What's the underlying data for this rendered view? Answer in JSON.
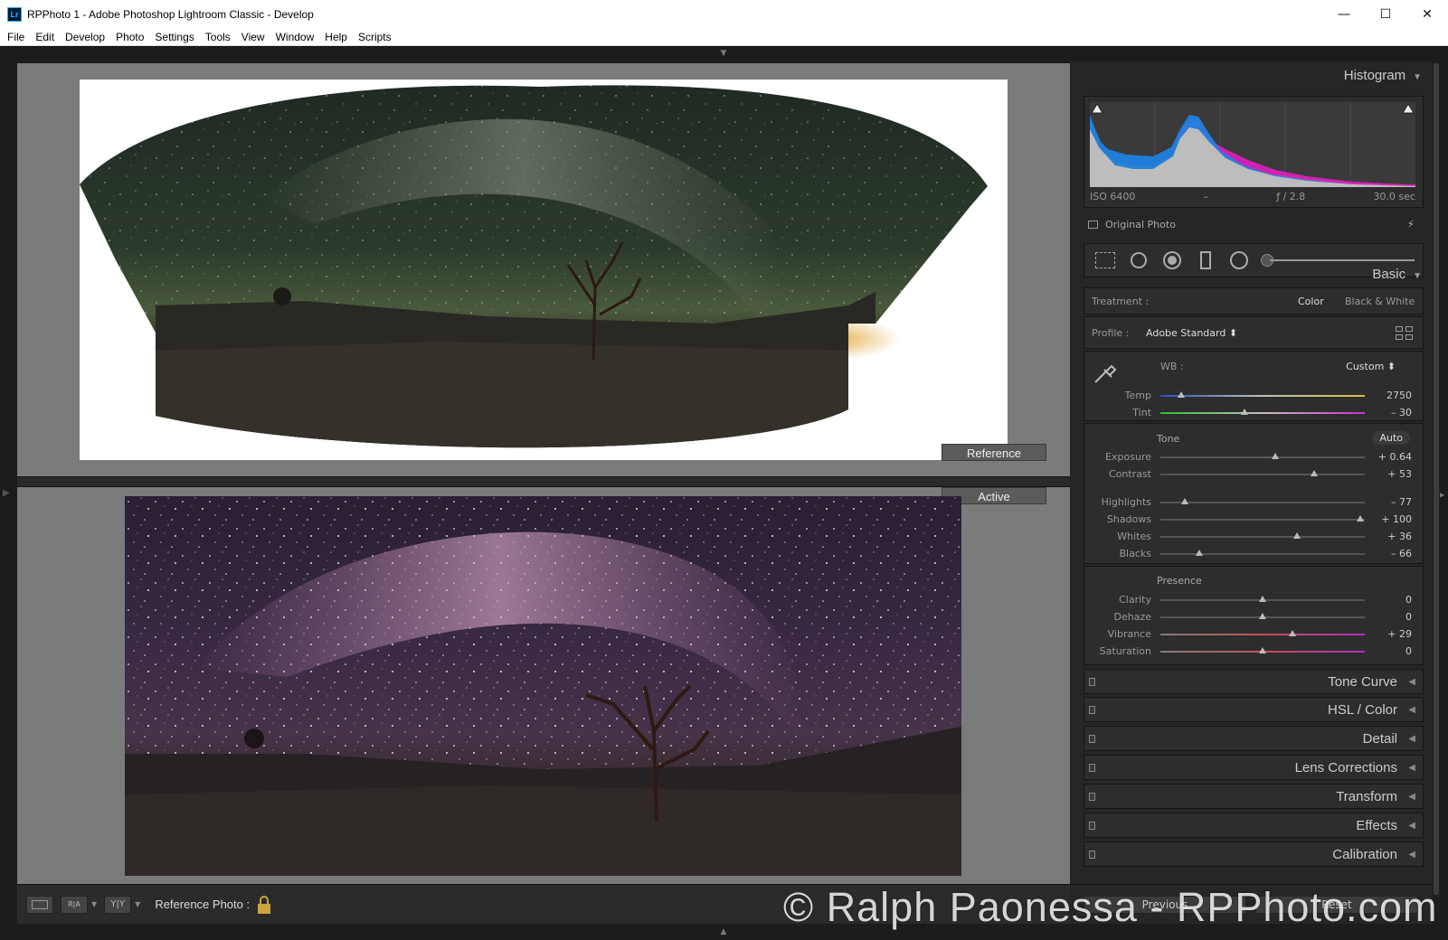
{
  "window": {
    "title": "RPPhoto 1 - Adobe Photoshop Lightroom Classic - Develop",
    "app_icon": "Lr",
    "controls": [
      "—",
      "☐",
      "✕"
    ]
  },
  "menu": [
    "File",
    "Edit",
    "Develop",
    "Photo",
    "Settings",
    "Tools",
    "View",
    "Window",
    "Help",
    "Scripts"
  ],
  "compare": {
    "reference_label": "Reference",
    "active_label": "Active"
  },
  "toolbar": {
    "reference_photo_label": "Reference Photo :",
    "view_ra": "R|A",
    "view_yy": "Y|Y"
  },
  "watermark": "© Ralph Paonessa - RPPhoto.com",
  "panel": {
    "histogram": {
      "title": "Histogram",
      "iso": "ISO 6400",
      "focal": "–",
      "aperture": "ƒ / 2.8",
      "shutter": "30.0 sec",
      "original_photo": "Original Photo"
    },
    "basic": {
      "title": "Basic",
      "treatment_label": "Treatment :",
      "treatment_color": "Color",
      "treatment_bw": "Black & White",
      "profile_label": "Profile :",
      "profile_value": "Adobe Standard ⬍",
      "wb_label": "WB :",
      "wb_value": "Custom ⬍",
      "tone_label": "Tone",
      "auto_label": "Auto",
      "presence_label": "Presence",
      "wb_sliders": [
        {
          "label": "Temp",
          "value": "2750",
          "pos": 0.1
        },
        {
          "label": "Tint",
          "value": "– 30",
          "pos": 0.41
        }
      ],
      "tone_sliders_a": [
        {
          "label": "Exposure",
          "value": "+ 0.64",
          "pos": 0.56
        },
        {
          "label": "Contrast",
          "value": "+ 53",
          "pos": 0.75
        }
      ],
      "tone_sliders_b": [
        {
          "label": "Highlights",
          "value": "– 77",
          "pos": 0.12
        },
        {
          "label": "Shadows",
          "value": "+ 100",
          "pos": 0.98
        },
        {
          "label": "Whites",
          "value": "+ 36",
          "pos": 0.67
        },
        {
          "label": "Blacks",
          "value": "– 66",
          "pos": 0.19
        }
      ],
      "presence_sliders": [
        {
          "label": "Clarity",
          "value": "0",
          "pos": 0.5
        },
        {
          "label": "Dehaze",
          "value": "0",
          "pos": 0.5
        },
        {
          "label": "Vibrance",
          "value": "+ 29",
          "pos": 0.645
        },
        {
          "label": "Saturation",
          "value": "0",
          "pos": 0.5
        }
      ]
    },
    "sections": [
      "Tone Curve",
      "HSL / Color",
      "Detail",
      "Lens Corrections",
      "Transform",
      "Effects",
      "Calibration"
    ],
    "previous_label": "Previous",
    "reset_label": "Reset"
  }
}
